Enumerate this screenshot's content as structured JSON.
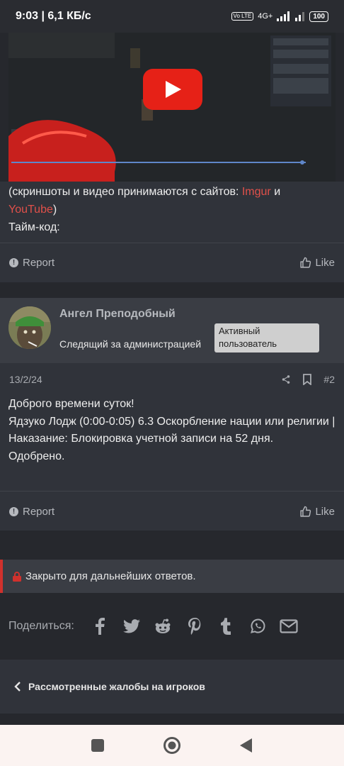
{
  "status_bar": {
    "time_speed": "9:03 | 6,1 КБ/с",
    "network": "4G+",
    "volte": "Vo LTE",
    "battery": "100"
  },
  "video": {
    "play_icon": "youtube-play-icon"
  },
  "post1": {
    "line1_a": "(скриншоты и видео принимаются с сайтов: ",
    "link_imgur": "Imgur",
    "line1_b": " и",
    "link_youtube": "YouTube",
    "line2_close": ")",
    "line3": "Тайм-код:",
    "report_label": "Report",
    "like_label": "Like"
  },
  "post2": {
    "username": "Ангел Преподобный",
    "user_title": "Следящий за администрацией",
    "badge": "Активный пользователь",
    "date": "13/2/24",
    "post_number": "#2",
    "body": [
      "Доброго времени суток!",
      "Ядзуко Лодж (0:00-0:05) 6.3 Оскорбление нации или религии | Наказание: Блокировка учетной записи на 52 дня.",
      "Одобрено."
    ],
    "report_label": "Report",
    "like_label": "Like"
  },
  "locked_notice": "Закрыто для дальнейших ответов.",
  "share": {
    "label": "Поделиться:",
    "icons": [
      "facebook-icon",
      "twitter-icon",
      "reddit-icon",
      "pinterest-icon",
      "tumblr-icon",
      "whatsapp-icon",
      "email-icon"
    ]
  },
  "breadcrumb": {
    "label": "Рассмотренные жалобы на игроков"
  },
  "colors": {
    "accent_link": "#e0504a",
    "lock_red": "#d0312d",
    "page_bg": "#26282d",
    "card_bg": "#30333a"
  }
}
